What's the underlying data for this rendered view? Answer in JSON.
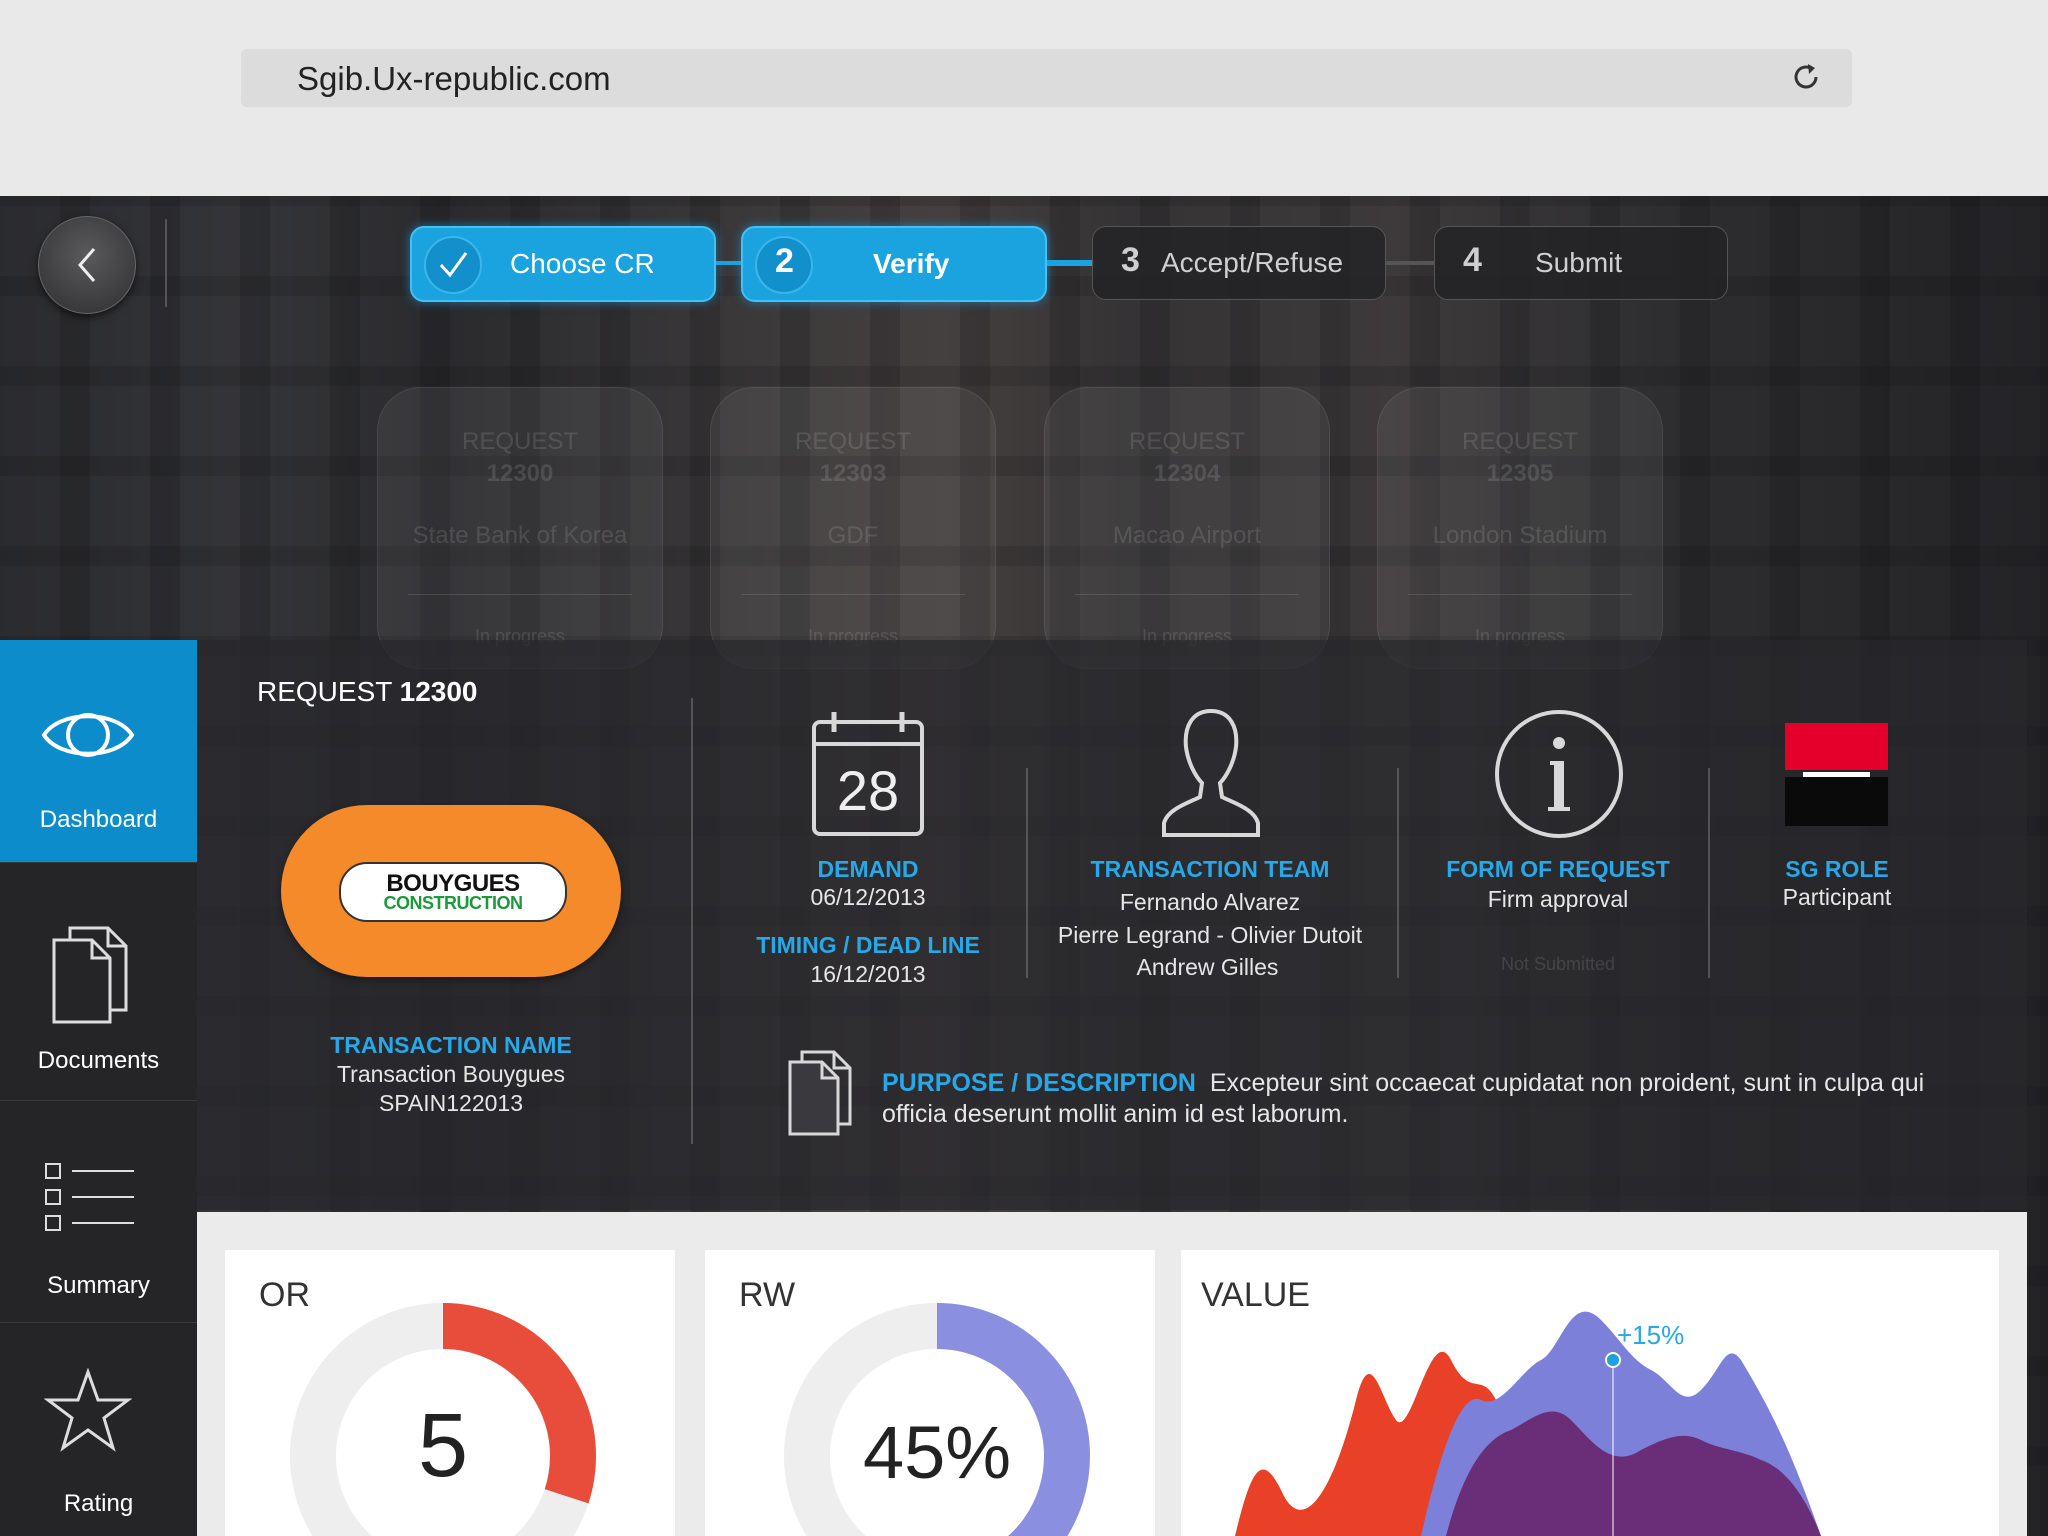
{
  "browser": {
    "url": "Sgib.Ux-republic.com"
  },
  "steps": [
    {
      "number": "",
      "label": "Choose CR"
    },
    {
      "number": "2",
      "label": "Verify"
    },
    {
      "number": "3",
      "label": "Accept/Refuse"
    },
    {
      "number": "4",
      "label": "Submit"
    }
  ],
  "ghost_cards": [
    {
      "title": "REQUEST",
      "number": "12300",
      "name": "State Bank of Korea",
      "status": "In progress"
    },
    {
      "title": "REQUEST",
      "number": "12303",
      "name": "GDF",
      "status": "In progress"
    },
    {
      "title": "REQUEST",
      "number": "12304",
      "name": "Macao Airport",
      "status": "In progress"
    },
    {
      "title": "REQUEST",
      "number": "12305",
      "name": "London Stadium",
      "status": "In progress"
    }
  ],
  "sidebar": {
    "items": [
      {
        "label": "Dashboard"
      },
      {
        "label": "Documents"
      },
      {
        "label": "Summary"
      },
      {
        "label": "Rating"
      }
    ]
  },
  "request": {
    "title_prefix": "REQUEST",
    "number": "12300",
    "logo_line1": "BOUYGUES",
    "logo_line2": "CONSTRUCTION",
    "transaction_name_label": "TRANSACTION NAME",
    "transaction_name": "Transaction Bouygues",
    "transaction_code": "SPAIN122013",
    "calendar_day": "28",
    "demand_label": "DEMAND",
    "demand_date": "06/12/2013",
    "timing_label": "TIMING / DEAD LINE",
    "timing_date": "16/12/2013",
    "team_label": "TRANSACTION TEAM",
    "team_line1": "Fernando Alvarez",
    "team_line2": "Pierre Legrand - Olivier Dutoit",
    "team_line3": "Andrew Gilles",
    "form_label": "FORM OF REQUEST",
    "form_value": "Firm approval",
    "form_ghost_status": "Not Submitted",
    "sg_role_label": "SG ROLE",
    "sg_role_value": "Participant",
    "purpose_label": "PURPOSE / DESCRIPTION",
    "purpose_text": "Excepteur sint occaecat cupidatat non proident, sunt in culpa qui officia deserunt mollit anim id est laborum."
  },
  "metrics": {
    "or": {
      "title": "OR",
      "value": "5",
      "fraction": 0.3,
      "color": "#e84c3a"
    },
    "rw": {
      "title": "RW",
      "value": "45%",
      "fraction": 0.45,
      "color": "#8b8fe0"
    },
    "value": {
      "title": "VALUE",
      "annotation": "+15%"
    }
  },
  "colors": {
    "accent": "#1ba3e0",
    "sidebar_active": "#0d8ccb",
    "orange": "#f58a2a",
    "red": "#e84c3a",
    "purple": "#8b8fe0"
  }
}
